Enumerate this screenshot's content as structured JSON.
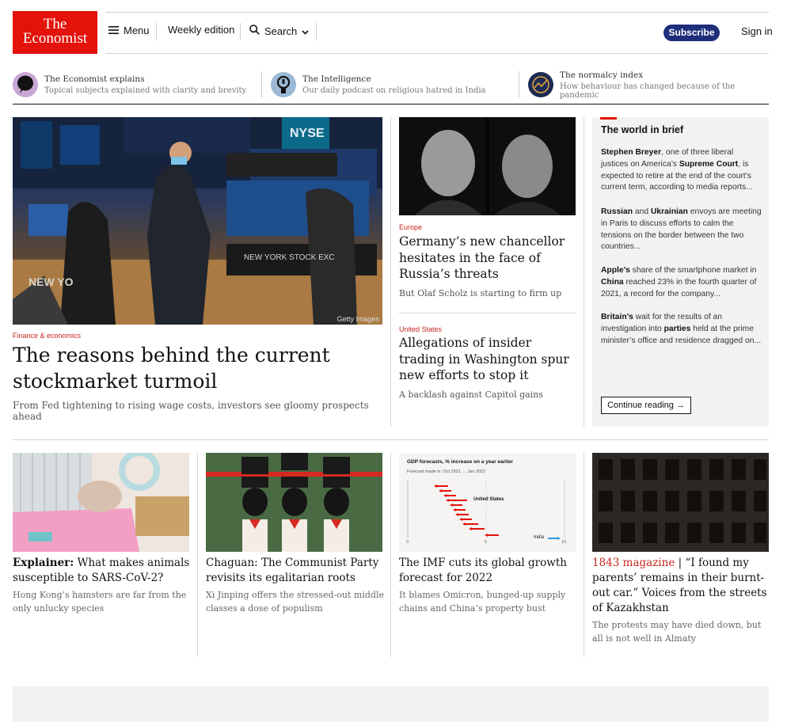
{
  "header": {
    "logo": {
      "line1": "The",
      "line2": "Economist"
    },
    "menu_label": "Menu",
    "weekly_label": "Weekly edition",
    "search_label": "Search",
    "subscribe_label": "Subscribe",
    "signin_label": "Sign in"
  },
  "promos": [
    {
      "title": "The Economist explains",
      "subtitle": "Topical subjects explained with clarity and brevity"
    },
    {
      "title": "The Intelligence",
      "subtitle": "Our daily podcast on religious hatred in India"
    },
    {
      "title": "The normalcy index",
      "subtitle": "How behaviour has changed because of the pandemic"
    }
  ],
  "hero": {
    "kicker": "Finance & economics",
    "title": "The reasons behind the current stockmarket turmoil",
    "subtitle": "From Fed tightening to rising wage costs, investors see gloomy prospects ahead",
    "image_credit": "Getty Images",
    "image_signs": {
      "nyse": "NYSE",
      "floor": "NEW YORK STOCK EXC",
      "floor2": "NEW YO"
    }
  },
  "middle": [
    {
      "kicker": "Europe",
      "title": "Germany’s new chancellor hesitates in the face of Russia’s threats",
      "subtitle": "But Olaf Scholz is starting to firm up"
    },
    {
      "kicker": "United States",
      "title": "Allegations of insider trading in Washington spur new efforts to stop it",
      "subtitle": "A backlash against Capitol gains"
    }
  ],
  "world_in_brief": {
    "title": "The world in brief",
    "items": [
      {
        "b1": "Stephen Breyer",
        "t1": ", one of three liberal justices on America’s ",
        "b2": "Supreme Court",
        "t2": ", is expected to retire at the end of the court’s current term, according to media reports..."
      },
      {
        "b1": "Russian",
        "t1": " and ",
        "b2": "Ukrainian",
        "t2": " envoys are meeting in Paris to discuss efforts to calm the tensions on the border between the two countries..."
      },
      {
        "b1": "Apple’s",
        "t1": " share of the smartphone market in ",
        "b2": "China",
        "t2": " reached 23% in the fourth quarter of 2021, a record for the company..."
      },
      {
        "b1": "Britain’s",
        "t1": " wait for the results of an investigation into ",
        "b2": "parties",
        "t2": " held at the prime minister’s office and residence dragged on..."
      }
    ],
    "button_label": "Continue reading →"
  },
  "cards": [
    {
      "lead": "Explainer:",
      "title": " What makes animals susceptible to SARS-CoV-2?",
      "subtitle": "Hong Kong’s hamsters are far from the only unlucky species"
    },
    {
      "lead": "",
      "title": "Chaguan: The Communist Party revisits its egalitarian roots",
      "subtitle": "Xi Jinping offers the stressed-out middle classes a dose of populism"
    },
    {
      "lead": "",
      "title": "The IMF cuts its global growth forecast for 2022",
      "subtitle": "It blames Omicron, bunged-up supply chains and China’s property bust"
    },
    {
      "lead": "1843 magazine",
      "title": " | “I found my parents’ remains in their burnt-out car.” Voices from the streets of Kazakhstan",
      "subtitle": "The protests may have died down, but all is not well in Almaty"
    }
  ],
  "mini_chart": {
    "title": "GDP forecasts, % increase on a year earlier",
    "legend": "Forecast made in: Oct 2021 → Jan 2022",
    "label_us": "United States",
    "label_india": "India",
    "ticks": [
      "0",
      "5",
      "10"
    ]
  },
  "colors": {
    "brand_red": "#e3120b",
    "subscribe_blue": "#1f2e7a",
    "kicker_red": "#c4261d"
  }
}
